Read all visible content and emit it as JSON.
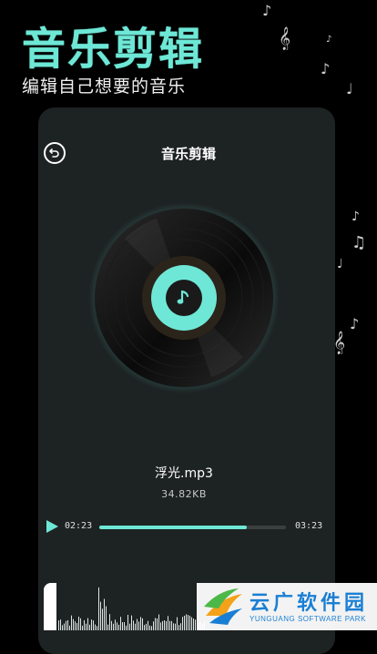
{
  "hero": {
    "title": "音乐剪辑",
    "subtitle": "编辑自己想要的音乐"
  },
  "panel": {
    "title": "音乐剪辑",
    "back_icon": "back-arrow-icon"
  },
  "player": {
    "file_name": "浮光.mp3",
    "file_size": "34.82KB",
    "current_time": "02:23",
    "total_time": "03:23",
    "progress": 0.79
  },
  "colors": {
    "accent": "#6ee7d6",
    "panel": "#1d2222",
    "background": "#000000"
  },
  "watermark": {
    "cn": "云广软件园",
    "en": "YUNGUANG SOFTWARE PARK"
  }
}
